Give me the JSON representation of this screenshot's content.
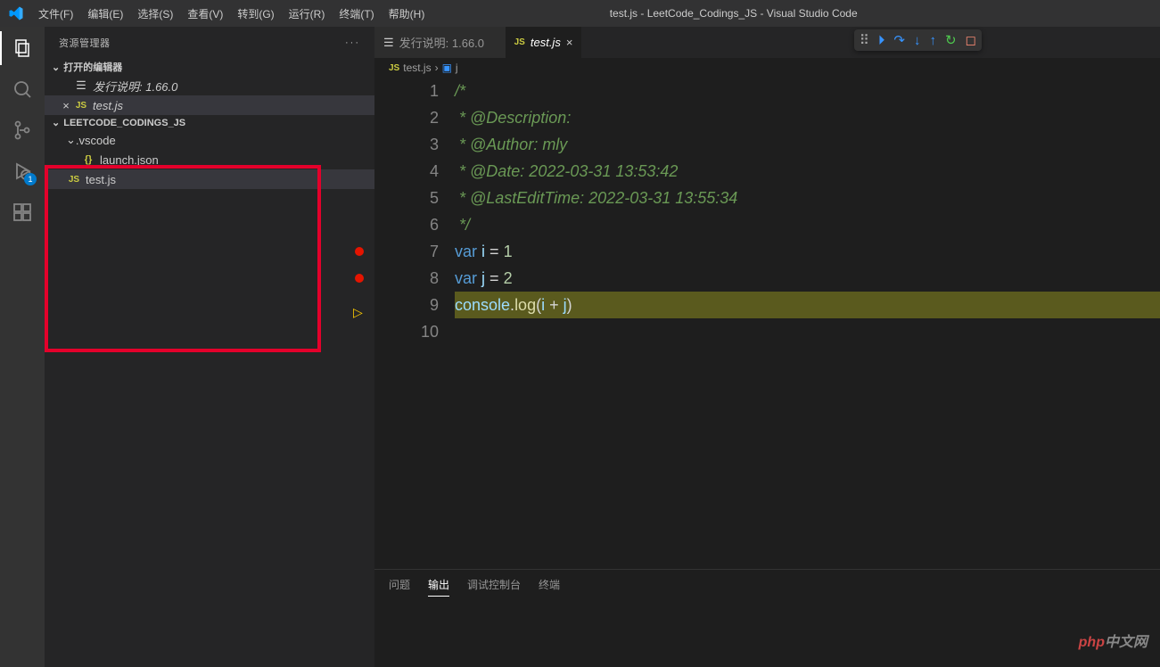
{
  "window": {
    "title": "test.js - LeetCode_Codings_JS - Visual Studio Code"
  },
  "menu": [
    "文件(F)",
    "编辑(E)",
    "选择(S)",
    "查看(V)",
    "转到(G)",
    "运行(R)",
    "终端(T)",
    "帮助(H)"
  ],
  "sidebar": {
    "title": "资源管理器",
    "open_editors_label": "打开的编辑器",
    "open_items": [
      {
        "label": "发行说明: 1.66.0",
        "icon": "md",
        "italic": true,
        "active": false
      },
      {
        "label": "test.js",
        "icon": "js",
        "italic": true,
        "active": true
      }
    ],
    "project": "LEETCODE_CODINGS_JS",
    "tree": [
      {
        "label": ".vscode",
        "kind": "folder",
        "depth": 1
      },
      {
        "label": "launch.json",
        "kind": "json",
        "depth": 2
      },
      {
        "label": "test.js",
        "kind": "js",
        "depth": 1,
        "active": true
      }
    ]
  },
  "activity_badge": "1",
  "tabs": [
    {
      "label": "发行说明: 1.66.0",
      "icon": "md",
      "active": false
    },
    {
      "label": "test.js",
      "icon": "js",
      "active": true,
      "italic": true
    }
  ],
  "breadcrumb": {
    "file": "test.js",
    "symbol": "j",
    "file_icon": "js",
    "symbol_icon": "var"
  },
  "code": {
    "lines": [
      {
        "n": 1,
        "t": "comment",
        "text": "/*"
      },
      {
        "n": 2,
        "t": "comment",
        "text": " * @Description:"
      },
      {
        "n": 3,
        "t": "comment",
        "text": " * @Author: mly"
      },
      {
        "n": 4,
        "t": "comment",
        "text": " * @Date: 2022-03-31 13:53:42"
      },
      {
        "n": 5,
        "t": "comment",
        "text": " * @LastEditTime: 2022-03-31 13:55:34"
      },
      {
        "n": 6,
        "t": "comment",
        "text": " */"
      },
      {
        "n": 7,
        "t": "var",
        "name": "i",
        "val": "1",
        "bp": true
      },
      {
        "n": 8,
        "t": "var",
        "name": "j",
        "val": "2",
        "bp": true
      },
      {
        "n": 9,
        "t": "log",
        "expr": "i + j",
        "hl": true,
        "cur": true
      },
      {
        "n": 10,
        "t": "empty"
      }
    ]
  },
  "panel_tabs": [
    "问题",
    "输出",
    "调试控制台",
    "终端"
  ],
  "panel_active": 1,
  "watermark": {
    "a": "php",
    "b": "中文网"
  }
}
